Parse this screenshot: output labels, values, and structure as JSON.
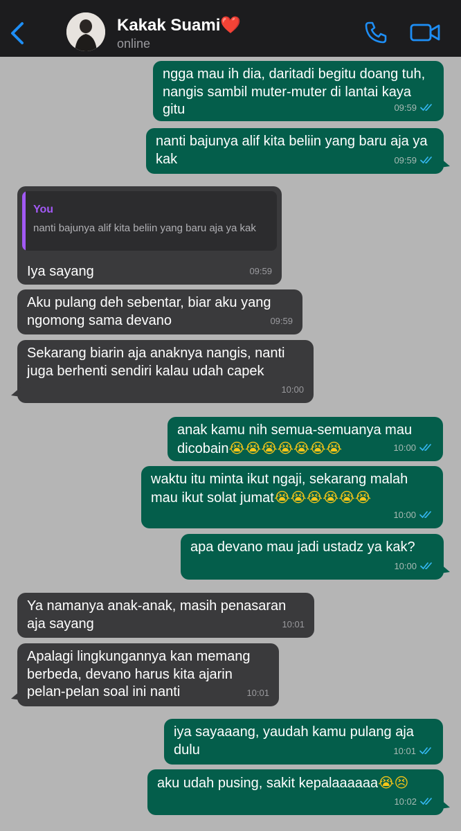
{
  "header": {
    "back_icon": "chevron-left-icon",
    "contact_name": "Kakak Suami",
    "contact_emoji": "❤️",
    "status": "online",
    "call_icon": "phone-icon",
    "video_icon": "video-camera-icon"
  },
  "colors": {
    "outgoing": "#045e4b",
    "incoming": "#3a3a3c",
    "background": "#b5b5b5",
    "accent": "#1e8ef5",
    "quote_author": "#a259f5"
  },
  "messages": [
    {
      "direction": "out",
      "text": "ngga mau ih dia, daritadi begitu doang tuh, nangis sambil muter-muter di lantai kaya gitu",
      "time": "09:59",
      "read": true
    },
    {
      "direction": "out",
      "text": "nanti bajunya alif kita beliin yang baru aja ya kak",
      "time": "09:59",
      "read": true
    },
    {
      "direction": "in",
      "reply_to": {
        "author": "You",
        "text": "nanti bajunya alif kita beliin yang baru aja ya kak"
      },
      "text": "Iya sayang",
      "time": "09:59"
    },
    {
      "direction": "in",
      "text": "Aku pulang deh sebentar, biar aku yang ngomong sama devano",
      "time": "09:59"
    },
    {
      "direction": "in",
      "text": "Sekarang biarin aja anaknya nangis, nanti juga berhenti sendiri kalau udah capek",
      "time": "10:00"
    },
    {
      "direction": "out",
      "text": "anak kamu nih semua-semuanya mau dicobain",
      "emoji": "😭😭😭😭😭😭😭",
      "time": "10:00",
      "read": true
    },
    {
      "direction": "out",
      "text": "waktu itu minta ikut ngaji, sekarang malah mau ikut solat jumat",
      "emoji": "😭😭😭😭😭😭",
      "time": "10:00",
      "read": true
    },
    {
      "direction": "out",
      "text": "apa devano mau jadi ustadz ya kak?",
      "time": "10:00",
      "read": true
    },
    {
      "direction": "in",
      "text": "Ya namanya anak-anak, masih penasaran aja sayang",
      "time": "10:01"
    },
    {
      "direction": "in",
      "text": "Apalagi lingkungannya kan memang berbeda, devano harus kita ajarin pelan-pelan soal ini nanti",
      "time": "10:01"
    },
    {
      "direction": "out",
      "text": "iya sayaaang, yaudah kamu pulang aja dulu",
      "time": "10:01",
      "read": true
    },
    {
      "direction": "out",
      "text": "aku udah pusing, sakit kepalaaaaaa",
      "emoji": "😭😣",
      "time": "10:02",
      "read": true
    }
  ]
}
